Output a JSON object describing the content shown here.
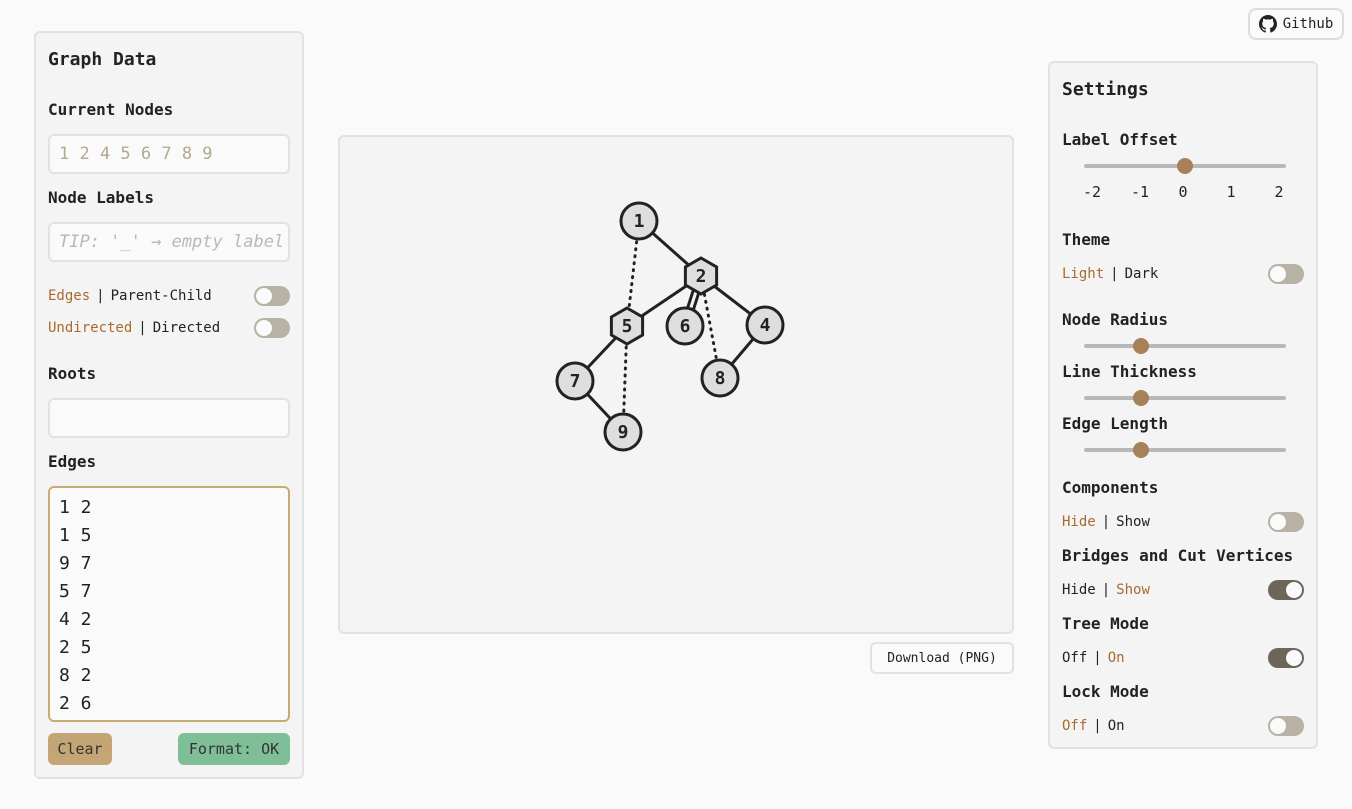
{
  "github": {
    "label": "Github",
    "icon": "github-icon"
  },
  "graph_data": {
    "title": "Graph Data",
    "current_nodes_label": "Current Nodes",
    "current_nodes_placeholder": "1 2 4 5 6 7 8 9",
    "node_labels_label": "Node Labels",
    "node_labels_placeholder": "TIP: '_' → empty label",
    "edges_toggle": {
      "option_a": "Edges",
      "option_b": "Parent-Child",
      "active": "a"
    },
    "direction_toggle": {
      "option_a": "Undirected",
      "option_b": "Directed",
      "active": "a"
    },
    "roots_label": "Roots",
    "roots_value": "",
    "edges_label": "Edges",
    "edges": [
      "1 2",
      "1 5",
      "9 7",
      "5 7",
      "4 2",
      "2 5",
      "8 2",
      "2 6"
    ],
    "clear_label": "Clear",
    "format_label": "Format: OK"
  },
  "graph": {
    "nodes": [
      "1",
      "2",
      "4",
      "5",
      "6",
      "7",
      "8",
      "9"
    ],
    "edges": [
      {
        "a": "1",
        "b": "2",
        "style": "solid"
      },
      {
        "a": "1",
        "b": "5",
        "style": "dotted"
      },
      {
        "a": "9",
        "b": "7",
        "style": "solid"
      },
      {
        "a": "5",
        "b": "7",
        "style": "solid"
      },
      {
        "a": "4",
        "b": "2",
        "style": "solid"
      },
      {
        "a": "2",
        "b": "5",
        "style": "solid"
      },
      {
        "a": "8",
        "b": "2",
        "style": "dotted"
      },
      {
        "a": "2",
        "b": "6",
        "style": "double"
      },
      {
        "a": "4",
        "b": "8",
        "style": "solid"
      },
      {
        "a": "5",
        "b": "9",
        "style": "dotted"
      }
    ],
    "cut_vertices": [
      "2",
      "5"
    ],
    "colors": {
      "node_fill": "#dedede",
      "stroke": "#222222"
    }
  },
  "download_label": "Download (PNG)",
  "settings": {
    "title": "Settings",
    "label_offset": {
      "label": "Label Offset",
      "value": 0,
      "ticks": [
        "-2",
        "-1",
        "0",
        "1",
        "2"
      ]
    },
    "theme": {
      "label": "Theme",
      "option_a": "Light",
      "option_b": "Dark",
      "active": "a"
    },
    "node_radius": {
      "label": "Node Radius",
      "value": 0.28
    },
    "line_thickness": {
      "label": "Line Thickness",
      "value": 0.28
    },
    "edge_length": {
      "label": "Edge Length",
      "value": 0.28
    },
    "components": {
      "label": "Components",
      "option_a": "Hide",
      "option_b": "Show",
      "active": "a"
    },
    "bridges": {
      "label": "Bridges and Cut Vertices",
      "option_a": "Hide",
      "option_b": "Show",
      "active": "b"
    },
    "tree_mode": {
      "label": "Tree Mode",
      "option_a": "Off",
      "option_b": "On",
      "active": "b"
    },
    "lock_mode": {
      "label": "Lock Mode",
      "option_a": "Off",
      "option_b": "On",
      "active": "a"
    }
  },
  "accent_colors": {
    "active_option": "#a86b2d",
    "slider_thumb": "#a8805a",
    "clear_button": "#c4a575",
    "format_button": "#7fbf98"
  }
}
